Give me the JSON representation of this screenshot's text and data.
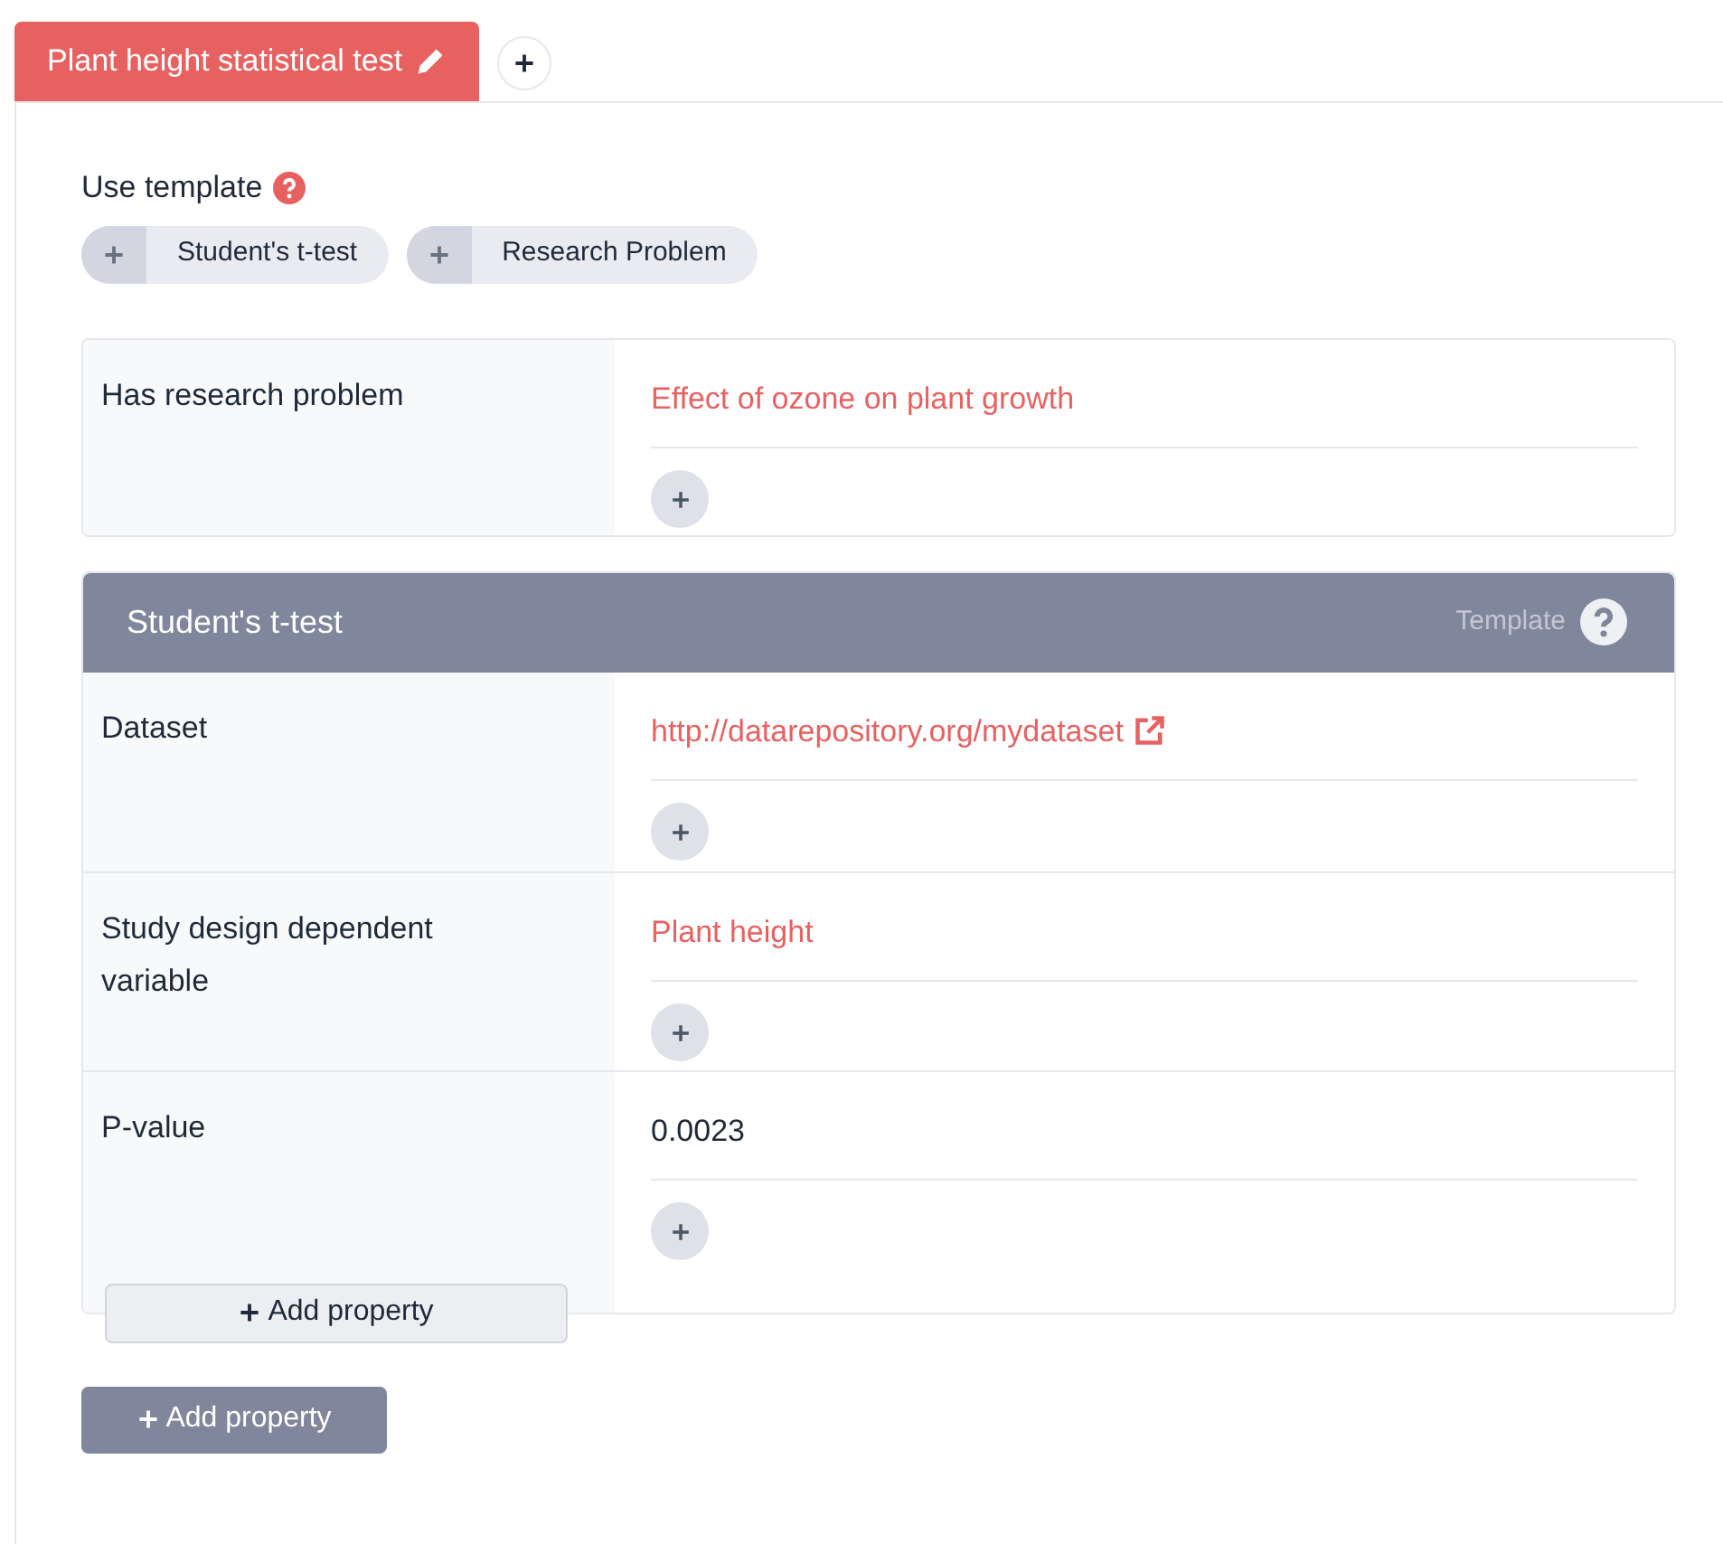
{
  "tabs": [
    {
      "label": "Plant height statistical test",
      "selected": true
    }
  ],
  "templates": {
    "label": "Use template",
    "items": [
      "Student's t-test",
      "Research Problem"
    ]
  },
  "statements": [
    {
      "property": "Has research problem",
      "values": [
        {
          "kind": "resource",
          "text": "Effect of ozone on plant growth"
        }
      ]
    }
  ],
  "template_card": {
    "title": "Student's t-test",
    "badge": "Template",
    "rows": [
      {
        "property": "Dataset",
        "values": [
          {
            "kind": "link",
            "text": "http://datarepository.org/mydataset"
          }
        ]
      },
      {
        "property": "Study design dependent variable",
        "values": [
          {
            "kind": "resource",
            "text": "Plant height"
          }
        ]
      },
      {
        "property": "P-value",
        "values": [
          {
            "kind": "literal",
            "text": "0.0023"
          }
        ]
      }
    ],
    "add_button": "Add property"
  },
  "add_button": "Add property"
}
